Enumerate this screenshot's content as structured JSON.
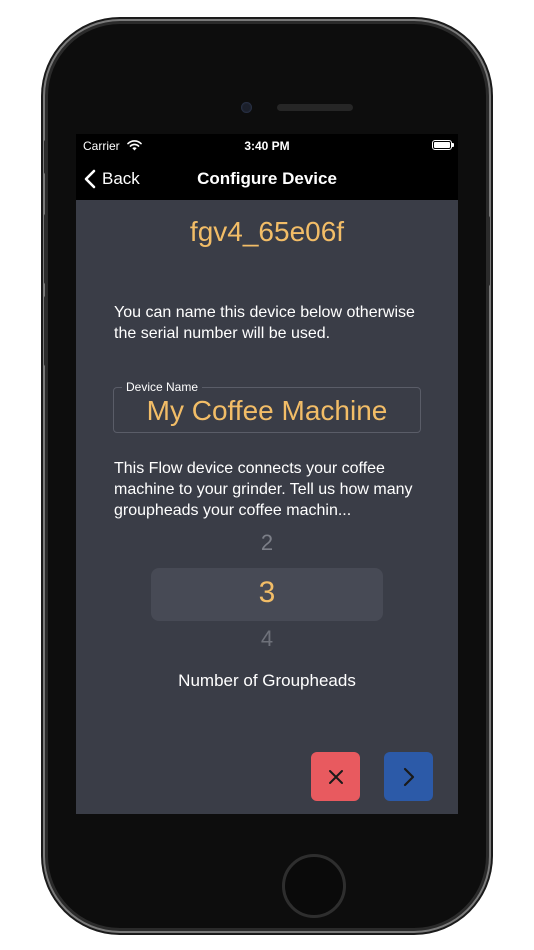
{
  "status_bar": {
    "carrier": "Carrier",
    "time": "3:40 PM"
  },
  "nav": {
    "back_label": "Back",
    "title": "Configure Device"
  },
  "device": {
    "serial": "fgv4_65e06f",
    "intro_text": "You can name this device below otherwise the serial number will be used.",
    "name_field": {
      "label": "Device Name",
      "value": "My Coffee Machine"
    },
    "grouphead_text": "This Flow device connects your coffee machine to your grinder. Tell us how many groupheads your coffee machin..."
  },
  "picker": {
    "prev": "2",
    "selected": "3",
    "next": "4",
    "caption": "Number of Groupheads"
  },
  "icons": {
    "cancel": "close-icon",
    "next": "chevron-right-icon",
    "back": "chevron-left-icon"
  },
  "colors": {
    "accent": "#f2bd67",
    "background": "#3a3d47",
    "cancel": "#e85a5f",
    "next": "#2c5aa8"
  }
}
